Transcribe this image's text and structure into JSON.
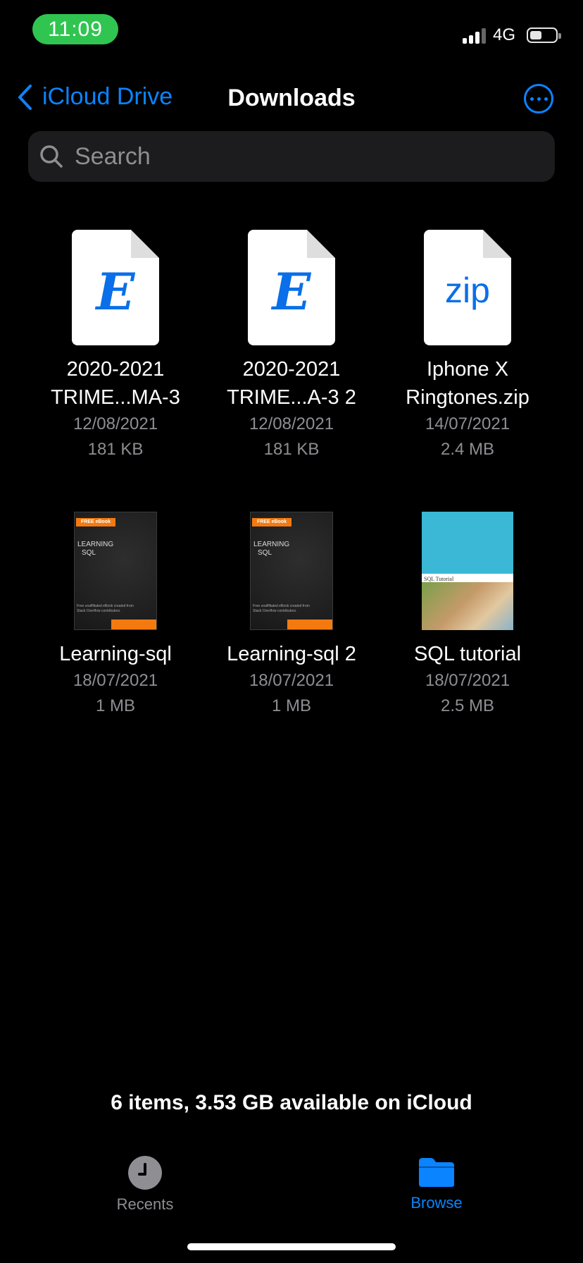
{
  "status": {
    "time": "11:09",
    "network": "4G"
  },
  "nav": {
    "back_label": "iCloud Drive",
    "title": "Downloads"
  },
  "search": {
    "placeholder": "Search"
  },
  "files": [
    {
      "name_line1": "2020-2021",
      "name_line2": "TRIME...MA-3",
      "date": "12/08/2021",
      "size": "181 KB",
      "icon": "E"
    },
    {
      "name_line1": "2020-2021",
      "name_line2": "TRIME...A-3 2",
      "date": "12/08/2021",
      "size": "181 KB",
      "icon": "E"
    },
    {
      "name_line1": "Iphone X",
      "name_line2": "Ringtones.zip",
      "date": "14/07/2021",
      "size": "2.4 MB",
      "icon": "zip"
    },
    {
      "name": "Learning-sql",
      "date": "18/07/2021",
      "size": "1 MB",
      "cover": {
        "badge": "FREE eBook",
        "line1": "LEARNING",
        "line2": "SQL",
        "footer1": "Free unaffiliated eBook created from",
        "footer2": "Stack Overflow contributors."
      }
    },
    {
      "name": "Learning-sql 2",
      "date": "18/07/2021",
      "size": "1 MB",
      "cover": {
        "badge": "FREE eBook",
        "line1": "LEARNING",
        "line2": "SQL",
        "footer1": "Free unaffiliated eBook created from",
        "footer2": "Stack Overflow contributors."
      }
    },
    {
      "name": "SQL tutorial",
      "date": "18/07/2021",
      "size": "2.5 MB",
      "cover": {
        "label": "SQL Tutorial"
      }
    }
  ],
  "footer": {
    "info": "6 items, 3.53 GB available on iCloud"
  },
  "tabs": [
    {
      "label": "Recents",
      "color": "#8e8e93"
    },
    {
      "label": "Browse",
      "color": "#0a84ff"
    }
  ],
  "colors": {
    "accent": "#0a84ff",
    "status_green": "#30c550",
    "doc_icon": "#0a6fe8"
  }
}
